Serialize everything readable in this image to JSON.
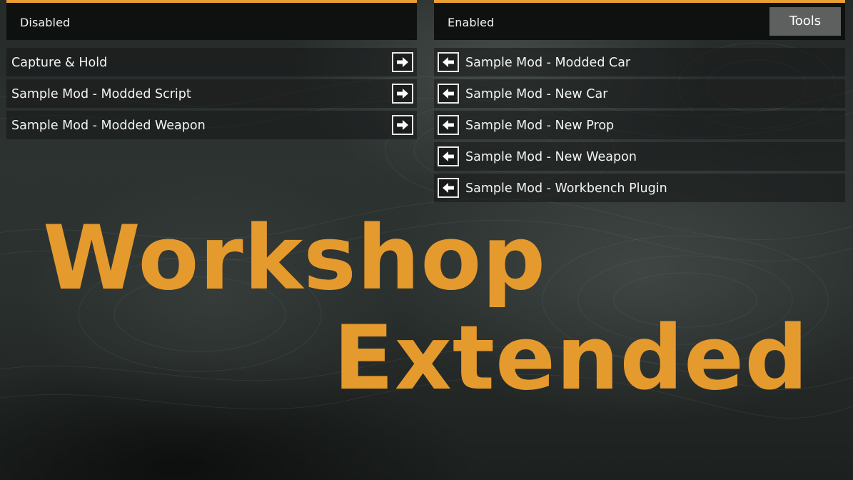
{
  "disabled_panel": {
    "title": "Disabled",
    "items": [
      {
        "label": "Capture & Hold"
      },
      {
        "label": "Sample Mod - Modded Script"
      },
      {
        "label": "Sample Mod - Modded Weapon"
      }
    ]
  },
  "enabled_panel": {
    "title": "Enabled",
    "tools_label": "Tools",
    "items": [
      {
        "label": "Sample Mod - Modded Car"
      },
      {
        "label": "Sample Mod - New Car"
      },
      {
        "label": "Sample Mod - New Prop"
      },
      {
        "label": "Sample Mod - New Weapon"
      },
      {
        "label": "Sample Mod - Workbench Plugin"
      }
    ]
  },
  "banner": {
    "line1": "Workshop",
    "line2": "Extended"
  },
  "icons": {
    "enable": "arrow-right-icon",
    "disable": "arrow-left-icon"
  },
  "colors": {
    "accent": "#e8a033",
    "title_text": "#e59a2e",
    "header_bg": "#0f1111",
    "tools_button_bg": "#5e5f5f"
  }
}
